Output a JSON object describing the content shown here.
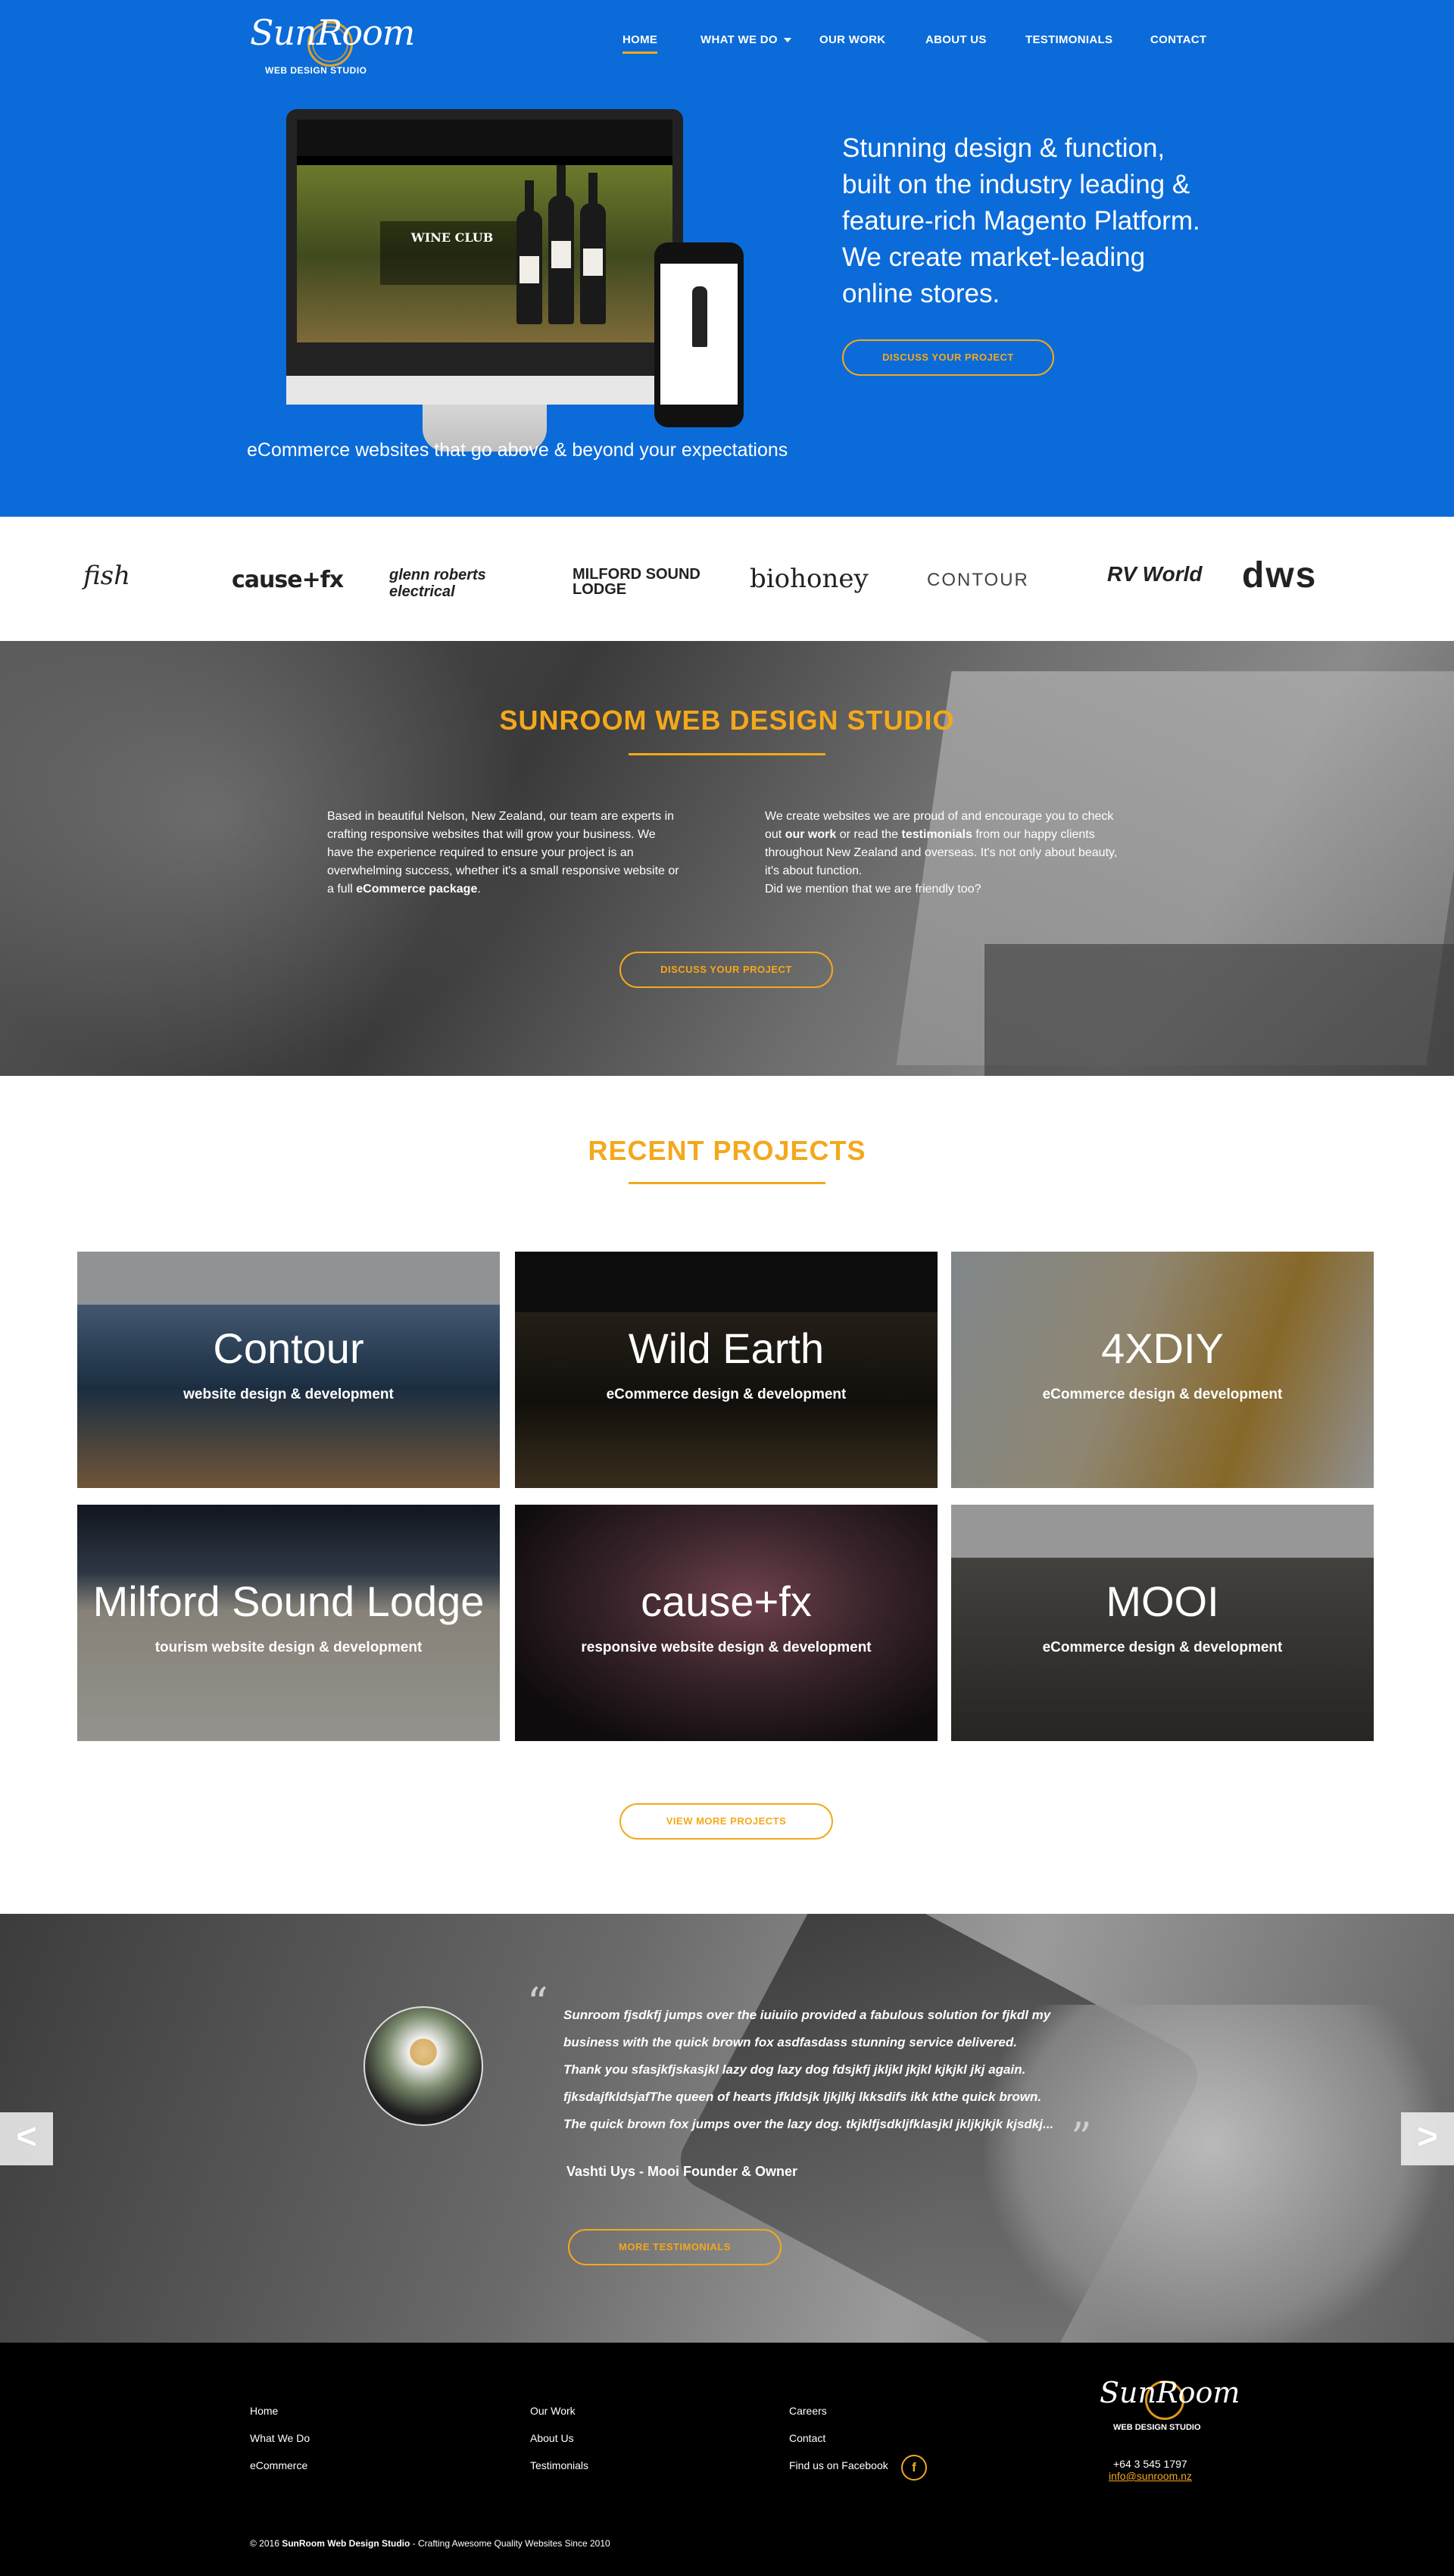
{
  "brand": {
    "logo_text": "SunRoom",
    "logo_sub": "WEB DESIGN STUDIO",
    "accent_color": "#f4a81c",
    "hero_color": "#0b6bd9"
  },
  "nav": {
    "items": [
      {
        "label": "HOME"
      },
      {
        "label": "WHAT WE DO"
      },
      {
        "label": "OUR WORK"
      },
      {
        "label": "ABOUT US"
      },
      {
        "label": "TESTIMONIALS"
      },
      {
        "label": "CONTACT"
      }
    ]
  },
  "hero": {
    "headline": "Stunning design & function, built on the industry leading & feature-rich Magento Platform. We create market-leading online stores.",
    "cta": "DISCUSS YOUR PROJECT",
    "caption": "eCommerce websites that go above & beyond your expectations",
    "mockup_title": "WINE CLUB"
  },
  "client_logos": [
    {
      "name": "fish"
    },
    {
      "name": "cause+fx"
    },
    {
      "name": "glenn roberts electrical"
    },
    {
      "name": "MILFORD SOUND LODGE"
    },
    {
      "name": "biohoney"
    },
    {
      "name": "CONTOUR"
    },
    {
      "name": "RV World"
    },
    {
      "name": "dws"
    }
  ],
  "studio": {
    "title": "SUNROOM WEB DESIGN STUDIO",
    "left_pre": "Based in beautiful Nelson, New Zealand, our team are experts in crafting responsive websites that will grow your business. We have the experience required to ensure your project is an overwhelming success, whether it's a small responsive website or a full ",
    "left_bold": "eCommerce package",
    "left_post": ".",
    "right_a": "We create websites we are proud of and encourage you to check out ",
    "right_b": "our work",
    "right_c": " or read the ",
    "right_d": "testimonials",
    "right_e": " from our happy clients throughout New Zealand and overseas. It's not only about beauty, it's about function.",
    "right_f": "Did we mention that we are friendly too?",
    "cta": "DISCUSS YOUR PROJECT"
  },
  "projects": {
    "title": "RECENT PROJECTS",
    "items": [
      {
        "title": "Contour",
        "subtitle": "website design & development"
      },
      {
        "title": "Wild Earth",
        "subtitle": "eCommerce design & development"
      },
      {
        "title": "4XDIY",
        "subtitle": "eCommerce design & development"
      },
      {
        "title": "Milford Sound Lodge",
        "subtitle": "tourism website design & development"
      },
      {
        "title": "cause+fx",
        "subtitle": "responsive website design & development"
      },
      {
        "title": "MOOI",
        "subtitle": "eCommerce design & development"
      }
    ],
    "cta": "VIEW MORE PROJECTS"
  },
  "testimonial": {
    "quote_lines": [
      "Sunroom fjsdkfj jumps over the iuiuiio provided a fabulous solution for fjkdl my",
      "business with the  quick brown fox asdfasdass stunning service delivered.",
      "Thank you sfasjkfjskasjkl lazy dog lazy dog fdsjkfj  jkljkl jkjkl kjkjkl  jkj again.",
      "fjksdajfkldsjafThe queen of hearts jfkldsjk ljkjlkj lkksdifs ikk kthe quick brown.",
      "The quick brown fox jumps over the lazy dog. tkjklfjsdkljfklasjkl jkljkjkjk kjsdkj..."
    ],
    "author": "Vashti Uys - Mooi Founder & Owner",
    "cta": "MORE TESTIMONIALS",
    "prev": "<",
    "next": ">"
  },
  "footer": {
    "col1": [
      "Home",
      "What We Do",
      "eCommerce"
    ],
    "col2": [
      "Our Work",
      "About Us",
      "Testimonials"
    ],
    "col3": [
      "Careers",
      "Contact",
      "Find us on Facebook"
    ],
    "phone": "+64 3 545 1797",
    "email": "info@sunroom.nz",
    "copyright_pre": "© 2016 ",
    "copyright_bold": "SunRoom Web Design Studio",
    "copyright_post": " - Crafting Awesome Quality Websites Since 2010"
  }
}
